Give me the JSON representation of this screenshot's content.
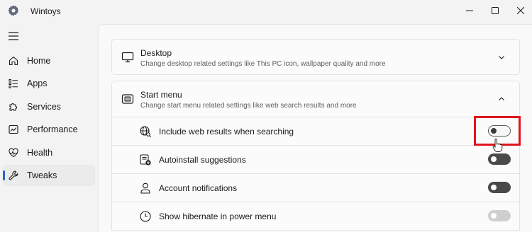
{
  "window": {
    "title": "Wintoys",
    "icons": {
      "app": "gear-icon",
      "minimize": "minimize-icon",
      "maximize": "maximize-icon",
      "close": "close-icon"
    }
  },
  "sidebar": {
    "menu_icon": "hamburger-icon",
    "items": [
      {
        "label": "Home",
        "icon": "home-icon",
        "active": false
      },
      {
        "label": "Apps",
        "icon": "apps-list-icon",
        "active": false
      },
      {
        "label": "Services",
        "icon": "puzzle-icon",
        "active": false
      },
      {
        "label": "Performance",
        "icon": "performance-chart-icon",
        "active": false
      },
      {
        "label": "Health",
        "icon": "heart-pulse-icon",
        "active": false
      },
      {
        "label": "Tweaks",
        "icon": "wrench-icon",
        "active": true
      }
    ]
  },
  "sections": {
    "desktop": {
      "title": "Desktop",
      "description": "Change desktop related settings like This PC icon, wallpaper quality and more",
      "icon": "monitor-icon",
      "expanded": false
    },
    "start_menu": {
      "title": "Start menu",
      "description": "Change start menu related settings like web search results and more",
      "icon": "start-menu-icon",
      "expanded": true,
      "settings": [
        {
          "label": "Include web results when searching",
          "icon": "globe-search-icon",
          "toggle": "off"
        },
        {
          "label": "Autoinstall suggestions",
          "icon": "app-add-icon",
          "toggle": "on"
        },
        {
          "label": "Account notifications",
          "icon": "person-icon",
          "toggle": "on"
        },
        {
          "label": "Show hibernate in power menu",
          "icon": "clock-icon",
          "toggle": "disabled"
        }
      ]
    }
  },
  "colors": {
    "accent": "#2b63c4",
    "highlight": "#e0141c"
  }
}
